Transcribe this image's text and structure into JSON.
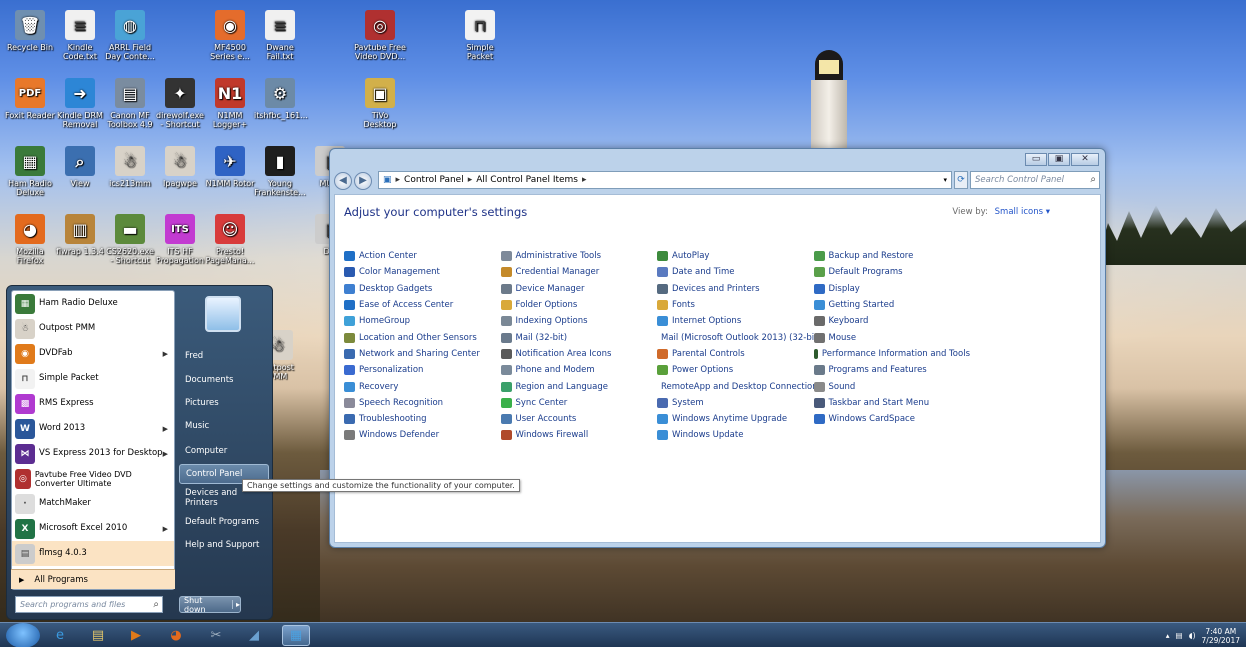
{
  "desktop": {
    "icons": [
      {
        "label": "Recycle Bin",
        "glyph": "🗑",
        "bg": "#6f8fb0"
      },
      {
        "label": "Kindle Code.txt",
        "glyph": "≡",
        "bg": "#f0f0f0"
      },
      {
        "label": "ARRL Field Day Conte...",
        "glyph": "◍",
        "bg": "#4aa3d6"
      },
      {
        "label": "MF4500 Series e...",
        "glyph": "◉",
        "bg": "#e46c2c"
      },
      {
        "label": "Dwane Fail.txt",
        "glyph": "≡",
        "bg": "#f0f0f0"
      },
      {
        "label": "Pavtube Free Video DVD...",
        "glyph": "◎",
        "bg": "#b03030"
      },
      {
        "label": "Simple Packet",
        "glyph": "⊓",
        "bg": "#f2f2f2"
      },
      {
        "label": "Foxit Reader",
        "glyph": "PDF",
        "bg": "#e8782a"
      },
      {
        "label": "Kindle DRM Removal",
        "glyph": "➜",
        "bg": "#2d86d6"
      },
      {
        "label": "Canon MF Toolbox 4.9",
        "glyph": "▤",
        "bg": "#7a8ca0"
      },
      {
        "label": "direwolf.exe - Shortcut",
        "glyph": "✦",
        "bg": "#333333"
      },
      {
        "label": "N1MM Logger+",
        "glyph": "N1",
        "bg": "#c0392b"
      },
      {
        "label": "itshfbc_161...",
        "glyph": "⚙",
        "bg": "#6c8aa7"
      },
      {
        "label": "TiVo Desktop",
        "glyph": "▣",
        "bg": "#d2b04a"
      },
      {
        "label": "Ham Radio Deluxe",
        "glyph": "▦",
        "bg": "#3a7a3a"
      },
      {
        "label": "View",
        "glyph": "⌕",
        "bg": "#3b6fb0"
      },
      {
        "label": "ics213mm",
        "glyph": "☃",
        "bg": "#d8d2c8"
      },
      {
        "label": "Ipagwpe",
        "glyph": "☃",
        "bg": "#d8d2c8"
      },
      {
        "label": "N1MM Rotor",
        "glyph": "✈",
        "bg": "#2f63c4"
      },
      {
        "label": "Young Frankenste...",
        "glyph": "▮",
        "bg": "#1e1e1e"
      },
      {
        "label": "MULT",
        "glyph": "▯",
        "bg": "#cccccc"
      },
      {
        "label": "Mozilla Firefox",
        "glyph": "◕",
        "bg": "#e36a1e"
      },
      {
        "label": "flwrap 1.3.4",
        "glyph": "▥",
        "bg": "#b8843a"
      },
      {
        "label": "CS2620.exe - Shortcut",
        "glyph": "▬",
        "bg": "#5c8a3c"
      },
      {
        "label": "ITS HF Propagation",
        "glyph": "ITS",
        "bg": "#c23bd1"
      },
      {
        "label": "Presto! PageMana...",
        "glyph": "☺",
        "bg": "#d83b3b"
      },
      {
        "label": "DM",
        "glyph": "▯",
        "bg": "#cccccc"
      },
      {
        "label": "Outpost PMM",
        "glyph": "☃",
        "bg": "#d8d2c8"
      }
    ]
  },
  "window": {
    "controls": [
      "▭",
      "▣",
      "✕"
    ],
    "breadcrumb": [
      "Control Panel",
      "All Control Panel Items"
    ],
    "search_placeholder": "Search Control Panel",
    "title": "Adjust your computer's settings",
    "view_by_label": "View by:",
    "view_by_value": "Small icons ▾",
    "items": [
      [
        {
          "t": "Action Center",
          "c": "#1f6fc6"
        },
        {
          "t": "Administrative Tools",
          "c": "#7e8a9a"
        },
        {
          "t": "AutoPlay",
          "c": "#3d8b3d"
        },
        {
          "t": "Backup and Restore",
          "c": "#4a9b4a"
        }
      ],
      [
        {
          "t": "Color Management",
          "c": "#2a5ab0"
        },
        {
          "t": "Credential Manager",
          "c": "#c48a2a"
        },
        {
          "t": "Date and Time",
          "c": "#5a7ac0"
        },
        {
          "t": "Default Programs",
          "c": "#5aa04a"
        }
      ],
      [
        {
          "t": "Desktop Gadgets",
          "c": "#3e7fd0"
        },
        {
          "t": "Device Manager",
          "c": "#6c7a8a"
        },
        {
          "t": "Devices and Printers",
          "c": "#556a80"
        },
        {
          "t": "Display",
          "c": "#2f6ac4"
        }
      ],
      [
        {
          "t": "Ease of Access Center",
          "c": "#1f6fc6"
        },
        {
          "t": "Folder Options",
          "c": "#d9a93a"
        },
        {
          "t": "Fonts",
          "c": "#d9a93a"
        },
        {
          "t": "Getting Started",
          "c": "#3a8ed6"
        }
      ],
      [
        {
          "t": "HomeGroup",
          "c": "#3fa1d8"
        },
        {
          "t": "Indexing Options",
          "c": "#7a8896"
        },
        {
          "t": "Internet Options",
          "c": "#3a8ed6"
        },
        {
          "t": "Keyboard",
          "c": "#6a6a6a"
        }
      ],
      [
        {
          "t": "Location and Other Sensors",
          "c": "#7c8a3c"
        },
        {
          "t": "Mail (32-bit)",
          "c": "#6a7a8c"
        },
        {
          "t": "Mail (Microsoft Outlook 2013) (32-bit)",
          "c": "#6a7a8c"
        },
        {
          "t": "Mouse",
          "c": "#707070"
        }
      ],
      [
        {
          "t": "Network and Sharing Center",
          "c": "#3a6ab0"
        },
        {
          "t": "Notification Area Icons",
          "c": "#5a5a5a"
        },
        {
          "t": "Parental Controls",
          "c": "#d06a2a"
        },
        {
          "t": "Performance Information and Tools",
          "c": "#2d5a2d"
        }
      ],
      [
        {
          "t": "Personalization",
          "c": "#3a6ad0"
        },
        {
          "t": "Phone and Modem",
          "c": "#7a8a9a"
        },
        {
          "t": "Power Options",
          "c": "#5aa03a"
        },
        {
          "t": "Programs and Features",
          "c": "#6a7a8a"
        }
      ],
      [
        {
          "t": "Recovery",
          "c": "#3a8ed6"
        },
        {
          "t": "Region and Language",
          "c": "#3aa06a"
        },
        {
          "t": "RemoteApp and Desktop Connections",
          "c": "#4a6ab0"
        },
        {
          "t": "Sound",
          "c": "#8a8a8a"
        }
      ],
      [
        {
          "t": "Speech Recognition",
          "c": "#8a8a9a"
        },
        {
          "t": "Sync Center",
          "c": "#3ab04a"
        },
        {
          "t": "System",
          "c": "#4a6ab0"
        },
        {
          "t": "Taskbar and Start Menu",
          "c": "#4a5a7a"
        }
      ],
      [
        {
          "t": "Troubleshooting",
          "c": "#3a6ab0"
        },
        {
          "t": "User Accounts",
          "c": "#4a7ab0"
        },
        {
          "t": "Windows Anytime Upgrade",
          "c": "#3a8ed6"
        },
        {
          "t": "Windows CardSpace",
          "c": "#2f6ac4"
        }
      ],
      [
        {
          "t": "Windows Defender",
          "c": "#7a7a7a"
        },
        {
          "t": "Windows Firewall",
          "c": "#b04a2a"
        },
        {
          "t": "Windows Update",
          "c": "#3a8ed6"
        },
        {
          "t": "",
          "c": ""
        }
      ]
    ]
  },
  "start_menu": {
    "programs": [
      {
        "label": "Ham Radio Deluxe",
        "bg": "#3a7a3a",
        "g": "▦",
        "arrow": false
      },
      {
        "label": "Outpost PMM",
        "bg": "#d8d2c8",
        "g": "☃",
        "arrow": false
      },
      {
        "label": "DVDFab",
        "bg": "#e07a1a",
        "g": "◉",
        "arrow": true
      },
      {
        "label": "Simple Packet",
        "bg": "#f2f2f2",
        "g": "⊓",
        "arrow": false
      },
      {
        "label": "RMS Express",
        "bg": "#b03ad0",
        "g": "▩",
        "arrow": false
      },
      {
        "label": "Word 2013",
        "bg": "#2b579a",
        "g": "W",
        "arrow": true
      },
      {
        "label": "VS Express 2013 for Desktop",
        "bg": "#5c2d91",
        "g": "⋈",
        "arrow": true
      },
      {
        "label": "Pavtube Free Video DVD Converter Ultimate",
        "bg": "#b03030",
        "g": "◎",
        "arrow": false
      },
      {
        "label": "MatchMaker",
        "bg": "#dddddd",
        "g": "·",
        "arrow": false
      },
      {
        "label": "Microsoft Excel 2010",
        "bg": "#217346",
        "g": "X",
        "arrow": true
      },
      {
        "label": "flmsg 4.0.3",
        "bg": "#cccccc",
        "g": "▤",
        "arrow": false
      }
    ],
    "all_programs": "All Programs",
    "search_placeholder": "Search programs and files",
    "right_items": [
      "Fred",
      "Documents",
      "Pictures",
      "Music",
      "Computer",
      "Control Panel",
      "Devices and Printers",
      "Default Programs",
      "Help and Support"
    ],
    "shutdown": "Shut down",
    "tooltip": "Change settings and customize the functionality of your computer."
  },
  "taskbar": {
    "icons": [
      "e",
      "▤",
      "▶",
      "◕",
      "✂",
      "◢",
      "▦"
    ],
    "time": "7:40 AM",
    "date": "7/29/2017"
  }
}
